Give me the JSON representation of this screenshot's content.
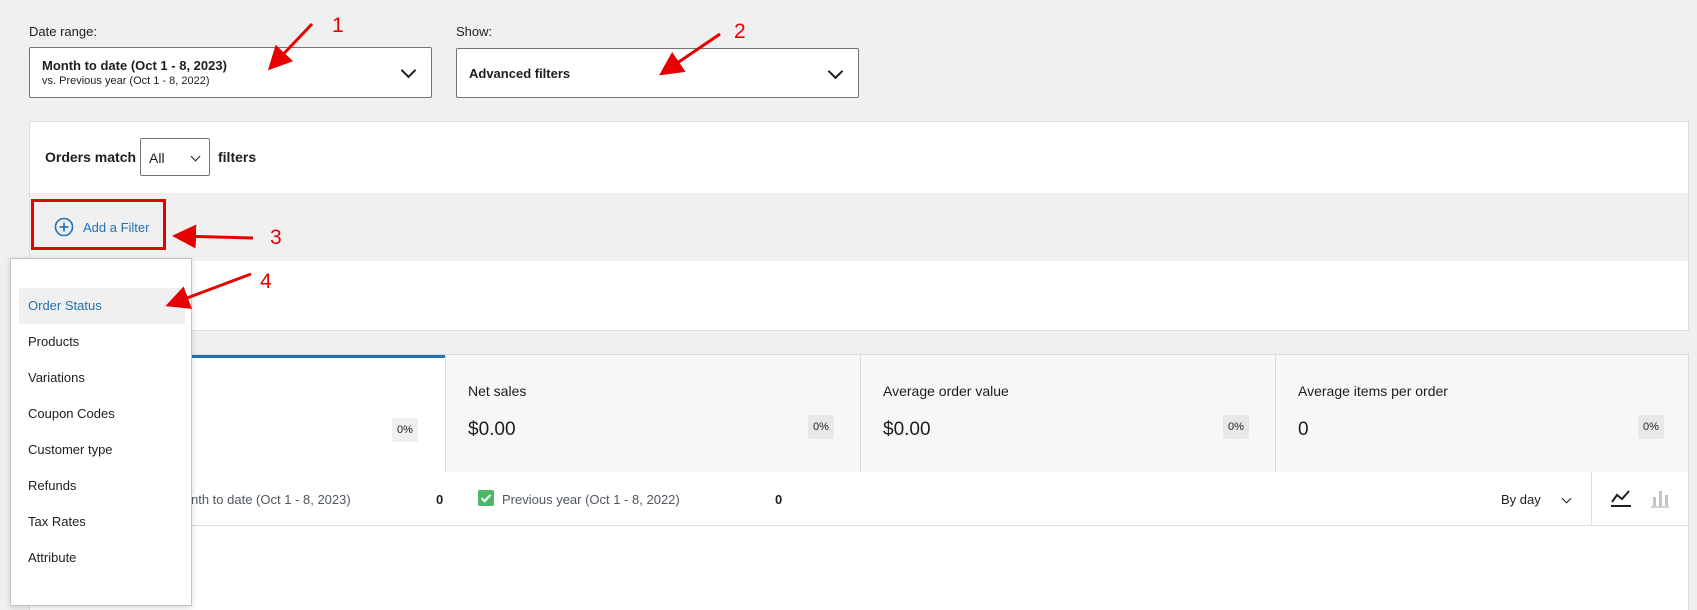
{
  "date_range": {
    "label": "Date range:",
    "primary": "Month to date (Oct 1 - 8, 2023)",
    "secondary": "vs. Previous year (Oct 1 - 8, 2022)"
  },
  "show": {
    "label": "Show:",
    "value": "Advanced filters"
  },
  "filters": {
    "prefix": "Orders match",
    "match_value": "All",
    "suffix": "filters",
    "add_filter_label": "Add a Filter"
  },
  "filter_menu": {
    "items": [
      {
        "label": "Order Status"
      },
      {
        "label": "Products"
      },
      {
        "label": "Variations"
      },
      {
        "label": "Coupon Codes"
      },
      {
        "label": "Customer type"
      },
      {
        "label": "Refunds"
      },
      {
        "label": "Tax Rates"
      },
      {
        "label": "Attribute"
      }
    ]
  },
  "stats": [
    {
      "label": "",
      "value": "",
      "pct": "0%"
    },
    {
      "label": "Net sales",
      "value": "$0.00",
      "pct": "0%"
    },
    {
      "label": "Average order value",
      "value": "$0.00",
      "pct": "0%"
    },
    {
      "label": "Average items per order",
      "value": "0",
      "pct": "0%"
    }
  ],
  "legend": {
    "current_label": "nth to date (Oct 1 - 8, 2023)",
    "current_value": "0",
    "previous_label": "Previous year (Oct 1 - 8, 2022)",
    "previous_value": "0",
    "interval": "By day"
  },
  "annotations": [
    "1",
    "2",
    "3",
    "4"
  ],
  "colors": {
    "accent": "#2271b1",
    "annotation": "#e60000",
    "checkbox": "#4ab866"
  }
}
